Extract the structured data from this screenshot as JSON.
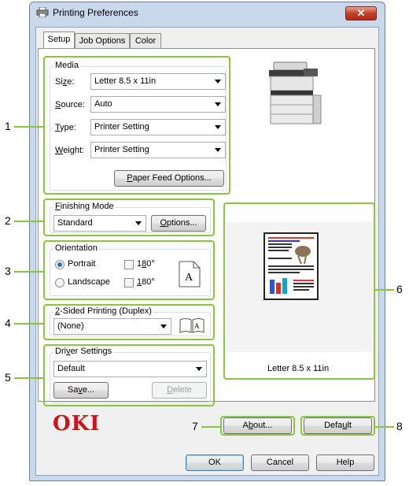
{
  "window": {
    "title": "Printing Preferences",
    "close_glyph": "✕"
  },
  "tabs": [
    {
      "label": "Setup",
      "active": true
    },
    {
      "label": "Job Options",
      "active": false
    },
    {
      "label": "Color",
      "active": false
    }
  ],
  "media": {
    "group_label": "Media",
    "size_label_pre": "Si",
    "size_label_u": "z",
    "size_label_post": "e:",
    "size_value": "Letter 8.5 x 11in",
    "source_label_u": "S",
    "source_label_post": "ource:",
    "source_value": "Auto",
    "type_label_u": "T",
    "type_label_post": "ype:",
    "type_value": "Printer Setting",
    "weight_label_u": "W",
    "weight_label_post": "eight:",
    "weight_value": "Printer Setting",
    "paper_feed_u": "P",
    "paper_feed_post": "aper Feed Options..."
  },
  "finishing": {
    "group_label_u": "F",
    "group_label_post": "inishing Mode",
    "value": "Standard",
    "options_u": "O",
    "options_post": "ptions..."
  },
  "orientation": {
    "group_label": "Orientation",
    "portrait": "Portrait",
    "landscape": "Landscape",
    "rotate1_pre": "1",
    "rotate1_u": "8",
    "rotate1_post": "0°",
    "rotate2_u": "1",
    "rotate2_post": "80°",
    "selected": "portrait",
    "preview_glyph": "A"
  },
  "duplex": {
    "group_label_u": "2",
    "group_label_post": "-Sided Printing (Duplex)",
    "value": "(None)",
    "icon_glyph": "A"
  },
  "driver": {
    "group_label_pre": "Dri",
    "group_label_u": "v",
    "group_label_post": "er Settings",
    "value": "Default",
    "save_pre": "Sa",
    "save_u": "v",
    "save_post": "e...",
    "delete_u": "D",
    "delete_post": "elete"
  },
  "preview": {
    "paper_label": "Letter 8.5 x 11in"
  },
  "brand": {
    "logo": "OKI",
    "color": "#cc1418"
  },
  "footer": {
    "about_pre": "A",
    "about_u": "b",
    "about_post": "out...",
    "default_pre": "Defa",
    "default_u": "u",
    "default_post": "lt",
    "ok": "OK",
    "cancel": "Cancel",
    "help": "Help"
  },
  "callouts": [
    "1",
    "2",
    "3",
    "4",
    "5",
    "6",
    "7",
    "8"
  ],
  "colors": {
    "highlight": "#8cc63f",
    "window_frame": "#c9d8ea"
  }
}
